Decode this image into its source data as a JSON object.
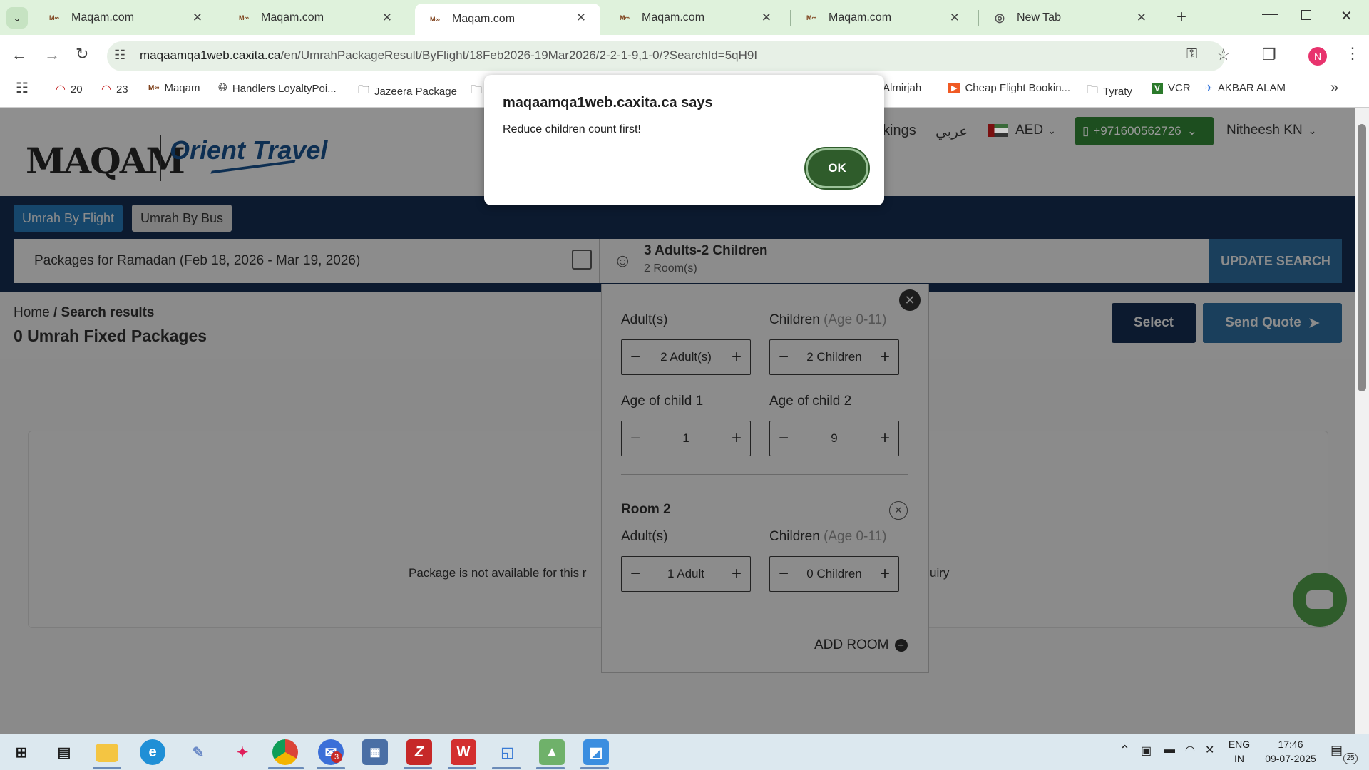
{
  "browser": {
    "tabs": [
      {
        "title": "Maqam.com"
      },
      {
        "title": "Maqam.com"
      },
      {
        "title": "Maqam.com"
      },
      {
        "title": "Maqam.com"
      },
      {
        "title": "Maqam.com"
      },
      {
        "title": "New Tab"
      }
    ],
    "active_tab_index": 2,
    "url_host": "maqaamqa1web.caxita.ca",
    "url_path": "/en/UmrahPackageResult/ByFlight/18Feb2026-19Mar2026/2-2-1-9,1-0/?SearchId=5qH9I",
    "profile_initial": "N",
    "bookmarks": [
      {
        "label": "20",
        "icon": "gauge-icon"
      },
      {
        "label": "23",
        "icon": "gauge-icon"
      },
      {
        "label": "Maqam",
        "icon": "maqam-icon"
      },
      {
        "label": "Handlers LoyaltyPoi...",
        "icon": "globe-icon"
      },
      {
        "label": "Jazeera Package",
        "icon": "folder-icon"
      },
      {
        "label": "Almirjah",
        "icon": "folder-icon"
      },
      {
        "label": "Cheap Flight Bookin...",
        "icon": "flight-icon"
      },
      {
        "label": "Tyraty",
        "icon": "folder-icon"
      },
      {
        "label": "VCR",
        "icon": "v-icon"
      },
      {
        "label": "AKBAR ALAM",
        "icon": "akbar-icon"
      }
    ]
  },
  "site": {
    "logo_text": "MAQAM",
    "logo_brand": "Orient Travel",
    "nav_partial": "kings",
    "lang_toggle": "عربي",
    "currency": "AED",
    "phone": "+971600562726",
    "user_name": "Nitheesh KN",
    "tabs": [
      "Umrah By Flight",
      "Umrah By Bus"
    ],
    "search_package": "Packages for Ramadan (Feb 18, 2026 - Mar 19, 2026)",
    "guests_summary": "3 Adults-2 Children",
    "rooms_summary": "2 Room(s)",
    "update_button": "UPDATE SEARCH",
    "breadcrumb_home": "Home",
    "breadcrumb_sep": "/",
    "breadcrumb_current": "Search results",
    "results_count": "0 Umrah Fixed Packages",
    "select_button": "Select",
    "send_quote_button": "Send Quote",
    "empty_left": "Package is not available for this r",
    "empty_right": "uiry"
  },
  "guests_panel": {
    "adults_label": "Adult(s)",
    "children_label": "Children",
    "children_age": "(Age 0-11)",
    "room1_adults": "2 Adult(s)",
    "room1_children": "2 Children",
    "child1_label": "Age of child 1",
    "child2_label": "Age of child 2",
    "child1_age": "1",
    "child2_age": "9",
    "room2_title": "Room 2",
    "room2_adults": "1 Adult",
    "room2_children": "0 Children",
    "add_room": "ADD ROOM"
  },
  "dialog": {
    "title": "maqaamqa1web.caxita.ca says",
    "message": "Reduce children count first!",
    "ok": "OK"
  },
  "taskbar": {
    "language": "ENG",
    "region": "IN",
    "time": "17:46",
    "date": "09-07-2025",
    "notification_count": "25",
    "mail_badge": "3"
  }
}
